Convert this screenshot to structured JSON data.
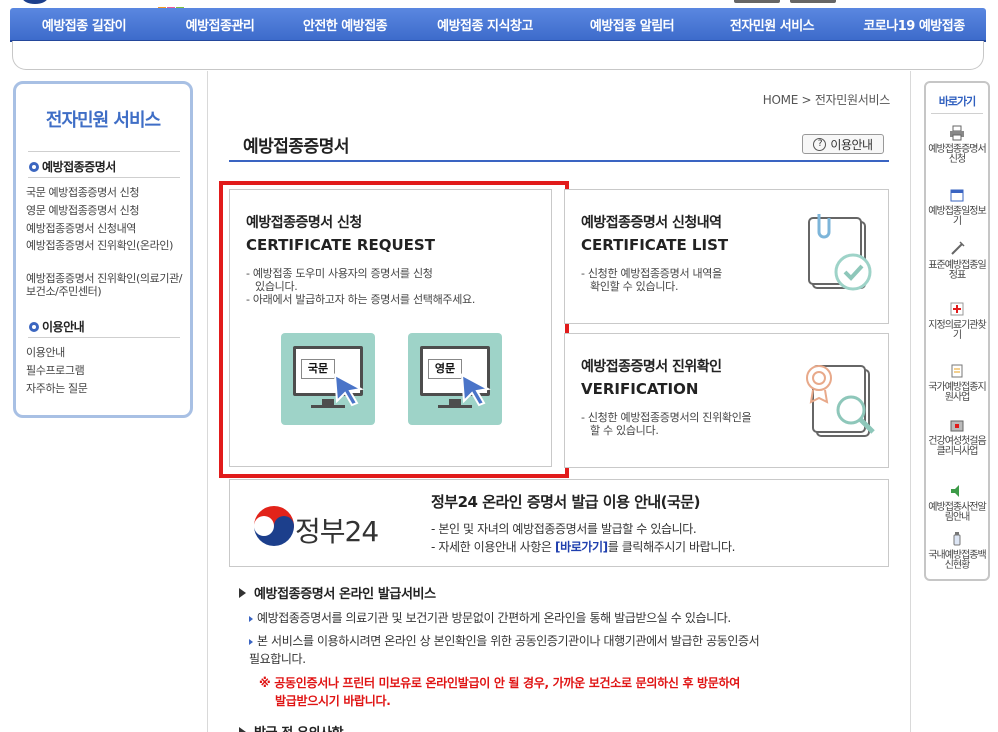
{
  "nav": {
    "items": [
      {
        "label": "예방접종 길잡이"
      },
      {
        "label": "예방접종관리"
      },
      {
        "label": "안전한 예방접종"
      },
      {
        "label": "예방접종 지식창고"
      },
      {
        "label": "예방접종 알림터"
      },
      {
        "label": "전자민원 서비스"
      },
      {
        "label": "코로나19 예방접종"
      }
    ]
  },
  "sidebar": {
    "title": "전자민원 서비스",
    "sections": [
      {
        "heading": "예방접종증명서",
        "links": [
          {
            "label": "국문 예방접종증명서 신청"
          },
          {
            "label": "영문 예방접종증명서 신청"
          },
          {
            "label": "예방접종증명서 신청내역"
          },
          {
            "label": "예방접종증명서 진위확인(온라인)"
          },
          {
            "label": "예방접종증명서 진위확인(의료기관/보건소/주민센터)"
          }
        ]
      },
      {
        "heading": "이용안내",
        "links": [
          {
            "label": "이용안내"
          },
          {
            "label": "필수프로그램"
          },
          {
            "label": "자주하는 질문"
          }
        ]
      }
    ]
  },
  "quick": {
    "title": "바로가기",
    "items": [
      {
        "label": "예방접종증명서 신청",
        "icon": "printer-icon"
      },
      {
        "label": "예방접종일정보기",
        "icon": "calendar-icon"
      },
      {
        "label": "표준예방접종일정표",
        "icon": "syringe-icon"
      },
      {
        "label": "지정의료기관찾기",
        "icon": "hospital-icon"
      },
      {
        "label": "국가예방접종지원사업",
        "icon": "document-icon"
      },
      {
        "label": "건강여성첫걸음클리닉사업",
        "icon": "box-icon"
      },
      {
        "label": "예방접종사전알림안내",
        "icon": "speaker-icon"
      },
      {
        "label": "국내예방접종백신현황",
        "icon": "vaccine-icon"
      }
    ]
  },
  "breadcrumb": {
    "home": "HOME",
    "sep": ">",
    "current": "전자민원서비스"
  },
  "page": {
    "title": "예방접종증명서",
    "guide_button": "이용안내"
  },
  "request": {
    "title": "예방접종증명서 신청",
    "en": "CERTIFICATE REQUEST",
    "desc1": "- 예방접종 도우미 사용자의 증명서를 신청",
    "desc1b": "있습니다.",
    "desc2": "- 아래에서 발급하고자 하는 증명서를 선택해주세요.",
    "korean_label": "국문",
    "english_label": "영문"
  },
  "list": {
    "title": "예방접종증명서 신청내역",
    "en": "CERTIFICATE LIST",
    "desc1": "- 신청한 예방접종증명서 내역을",
    "desc1b": "확인할 수 있습니다."
  },
  "verify": {
    "title": "예방접종증명서 진위확인",
    "en": "VERIFICATION",
    "desc1": "- 신청한 예방접종증명서의 진위확인을",
    "desc1b": "할 수 있습니다."
  },
  "gov24": {
    "logo": "정부24",
    "title": "정부24 온라인 증명서 발급 이용 안내(국문)",
    "line1": "- 본인 및 자녀의 예방접종증명서를 발급할 수 있습니다.",
    "line2_pre": "- 자세한 이용안내 사항은",
    "line2_link": "[바로가기]",
    "line2_post": "를 클릭해주시기 바랍니다."
  },
  "online": {
    "heading": "예방접종증명서 온라인 발급서비스",
    "p1": "예방접종증명서를 의료기관 및 보건기관 방문없이 간편하게 온라인을 통해 발급받으실 수 있습니다.",
    "p2a": "본 서비스를 이용하시려면 온라인 상 본인확인을 위한 공동인증기관이나 대행기관에서 발급한 공동인증서",
    "p2b": "필요합니다.",
    "warn1": "※ 공동인증서나 프린터 미보유로 온라인발급이 안 될 경우, 가까운 보건소로 문의하신 후 방문하여",
    "warn2": "발급받으시기 바랍니다.",
    "next_heading": "발급 전 유의사항"
  },
  "colors": {
    "accent": "#3a64c2",
    "highlight": "#e11b1b",
    "button": "#9ed3c8"
  }
}
